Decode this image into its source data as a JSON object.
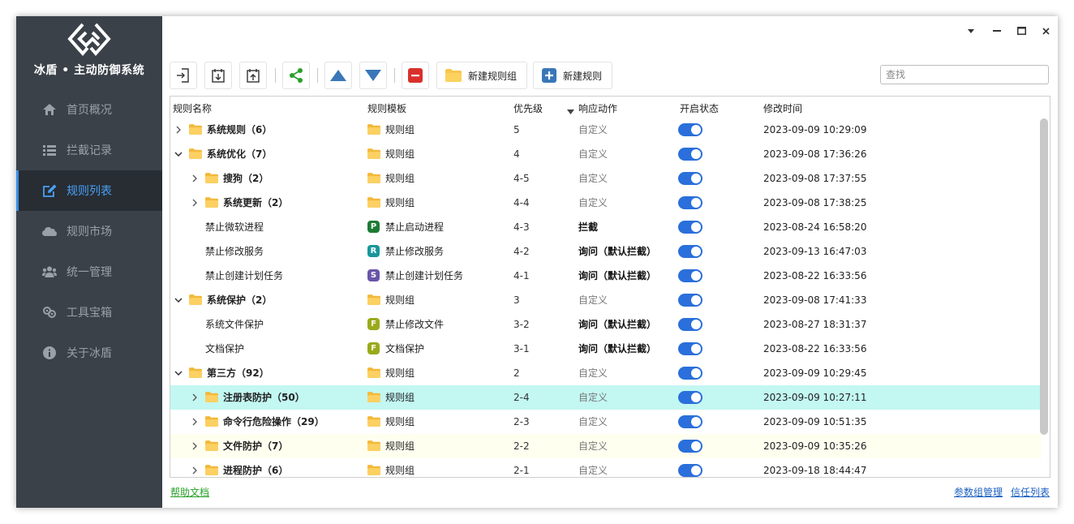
{
  "app": {
    "name": "冰盾 • 主动防御系统"
  },
  "nav": [
    {
      "label": "首页概况",
      "icon": "home-icon",
      "active": false
    },
    {
      "label": "拦截记录",
      "icon": "list-icon",
      "active": false
    },
    {
      "label": "规则列表",
      "icon": "edit-icon",
      "active": true
    },
    {
      "label": "规则市场",
      "icon": "cloud-icon",
      "active": false
    },
    {
      "label": "统一管理",
      "icon": "users-icon",
      "active": false
    },
    {
      "label": "工具宝箱",
      "icon": "tools-icon",
      "active": false
    },
    {
      "label": "关于冰盾",
      "icon": "info-icon",
      "active": false
    }
  ],
  "toolbar": {
    "new_group_label": "新建规则组",
    "new_rule_label": "新建规则",
    "search_placeholder": "查找"
  },
  "table": {
    "headers": {
      "name": "规则名称",
      "template": "规则模板",
      "priority": "优先级",
      "action": "响应动作",
      "status": "开启状态",
      "time": "修改时间"
    },
    "rows": [
      {
        "level": 0,
        "expand": "collapsed",
        "folder": true,
        "name": "系统规则（6）",
        "bold": true,
        "template": "规则组",
        "tpl_icon": "folder",
        "priority": "5",
        "action": "自定义",
        "action_style": "gray",
        "enabled": true,
        "time": "2023-09-09 10:29:09",
        "highlight": ""
      },
      {
        "level": 0,
        "expand": "expanded",
        "folder": true,
        "name": "系统优化（7）",
        "bold": true,
        "template": "规则组",
        "tpl_icon": "folder",
        "priority": "4",
        "action": "自定义",
        "action_style": "gray",
        "enabled": true,
        "time": "2023-09-08 17:36:26",
        "highlight": ""
      },
      {
        "level": 1,
        "expand": "collapsed",
        "folder": true,
        "name": "搜狗（2）",
        "bold": true,
        "template": "规则组",
        "tpl_icon": "folder",
        "priority": "4-5",
        "action": "自定义",
        "action_style": "gray",
        "enabled": true,
        "time": "2023-09-08 17:37:55",
        "highlight": ""
      },
      {
        "level": 1,
        "expand": "collapsed",
        "folder": true,
        "name": "系统更新（2）",
        "bold": true,
        "template": "规则组",
        "tpl_icon": "folder",
        "priority": "4-4",
        "action": "自定义",
        "action_style": "gray",
        "enabled": true,
        "time": "2023-09-08 17:38:25",
        "highlight": ""
      },
      {
        "level": 1,
        "expand": "none",
        "folder": false,
        "name": "禁止微软进程",
        "bold": false,
        "template": "禁止启动进程",
        "tpl_icon": "P",
        "tpl_color": "#1e7b34",
        "priority": "4-3",
        "action": "拦截",
        "action_style": "bold",
        "enabled": true,
        "time": "2023-08-24 16:58:20",
        "highlight": ""
      },
      {
        "level": 1,
        "expand": "none",
        "folder": false,
        "name": "禁止修改服务",
        "bold": false,
        "template": "禁止修改服务",
        "tpl_icon": "R",
        "tpl_color": "#17979b",
        "priority": "4-2",
        "action": "询问（默认拦截）",
        "action_style": "bold",
        "enabled": true,
        "time": "2023-09-13 16:47:03",
        "highlight": ""
      },
      {
        "level": 1,
        "expand": "none",
        "folder": false,
        "name": "禁止创建计划任务",
        "bold": false,
        "template": "禁止创建计划任务",
        "tpl_icon": "S",
        "tpl_color": "#6a55a8",
        "priority": "4-1",
        "action": "询问（默认拦截）",
        "action_style": "bold",
        "enabled": true,
        "time": "2023-08-22 16:33:56",
        "highlight": ""
      },
      {
        "level": 0,
        "expand": "expanded",
        "folder": true,
        "name": "系统保护（2）",
        "bold": true,
        "template": "规则组",
        "tpl_icon": "folder",
        "priority": "3",
        "action": "自定义",
        "action_style": "gray",
        "enabled": true,
        "time": "2023-09-08 17:41:33",
        "highlight": ""
      },
      {
        "level": 1,
        "expand": "none",
        "folder": false,
        "name": "系统文件保护",
        "bold": false,
        "template": "禁止修改文件",
        "tpl_icon": "F",
        "tpl_color": "#9aaa1a",
        "priority": "3-2",
        "action": "询问（默认拦截）",
        "action_style": "bold",
        "enabled": true,
        "time": "2023-08-27 18:31:37",
        "highlight": ""
      },
      {
        "level": 1,
        "expand": "none",
        "folder": false,
        "name": "文档保护",
        "bold": false,
        "template": "文档保护",
        "tpl_icon": "F",
        "tpl_color": "#9aaa1a",
        "priority": "3-1",
        "action": "询问（默认拦截）",
        "action_style": "bold",
        "enabled": true,
        "time": "2023-08-22 16:33:56",
        "highlight": ""
      },
      {
        "level": 0,
        "expand": "expanded",
        "folder": true,
        "name": "第三方（92）",
        "bold": true,
        "template": "规则组",
        "tpl_icon": "folder",
        "priority": "2",
        "action": "自定义",
        "action_style": "gray",
        "enabled": true,
        "time": "2023-09-09 10:29:45",
        "highlight": ""
      },
      {
        "level": 1,
        "expand": "collapsed",
        "folder": true,
        "name": "注册表防护（50）",
        "bold": true,
        "template": "规则组",
        "tpl_icon": "folder",
        "priority": "2-4",
        "action": "自定义",
        "action_style": "gray",
        "enabled": true,
        "time": "2023-09-09 10:27:11",
        "highlight": "cyan"
      },
      {
        "level": 1,
        "expand": "collapsed",
        "folder": true,
        "name": "命令行危险操作（29）",
        "bold": true,
        "template": "规则组",
        "tpl_icon": "folder",
        "priority": "2-3",
        "action": "自定义",
        "action_style": "gray",
        "enabled": true,
        "time": "2023-09-09 10:51:35",
        "highlight": ""
      },
      {
        "level": 1,
        "expand": "collapsed",
        "folder": true,
        "name": "文件防护（7）",
        "bold": true,
        "template": "规则组",
        "tpl_icon": "folder",
        "priority": "2-2",
        "action": "自定义",
        "action_style": "gray",
        "enabled": true,
        "time": "2023-09-09 10:35:26",
        "highlight": "yellow"
      },
      {
        "level": 1,
        "expand": "collapsed",
        "folder": true,
        "name": "进程防护（6）",
        "bold": true,
        "template": "规则组",
        "tpl_icon": "folder",
        "priority": "2-1",
        "action": "自定义",
        "action_style": "gray",
        "enabled": true,
        "time": "2023-09-18 18:44:47",
        "highlight": ""
      }
    ]
  },
  "footer": {
    "help_link": "帮助文档",
    "param_link": "参数组管理",
    "trust_link": "信任列表"
  },
  "colors": {
    "sidebar_bg": "#3a4149",
    "accent": "#3d8ee8",
    "toggle_on": "#2a6fdb",
    "help_link": "#2aa02a",
    "footer_link": "#1a5fc0"
  }
}
